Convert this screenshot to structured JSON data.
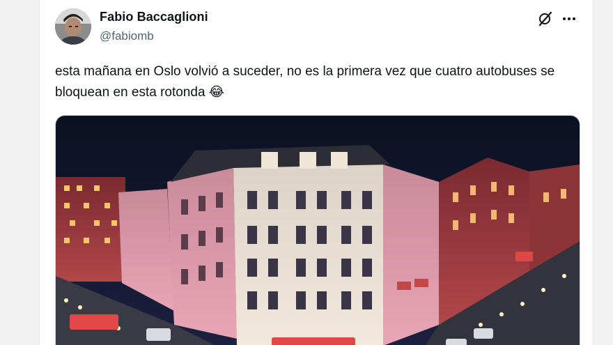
{
  "tweet": {
    "author_name": "Fabio Baccaglioni",
    "author_handle": "@fabiomb",
    "text": "esta mañana en Oslo volvió a suceder, no es la primera vez que cuatro autobuses se bloquean en esta rotonda 😂",
    "media_description_icon": "photo"
  },
  "icons": {
    "grok": "grok-icon",
    "more": "more-options-icon"
  },
  "colors": {
    "text_primary": "#0f1419",
    "text_secondary": "#536471",
    "background": "#ffffff"
  }
}
